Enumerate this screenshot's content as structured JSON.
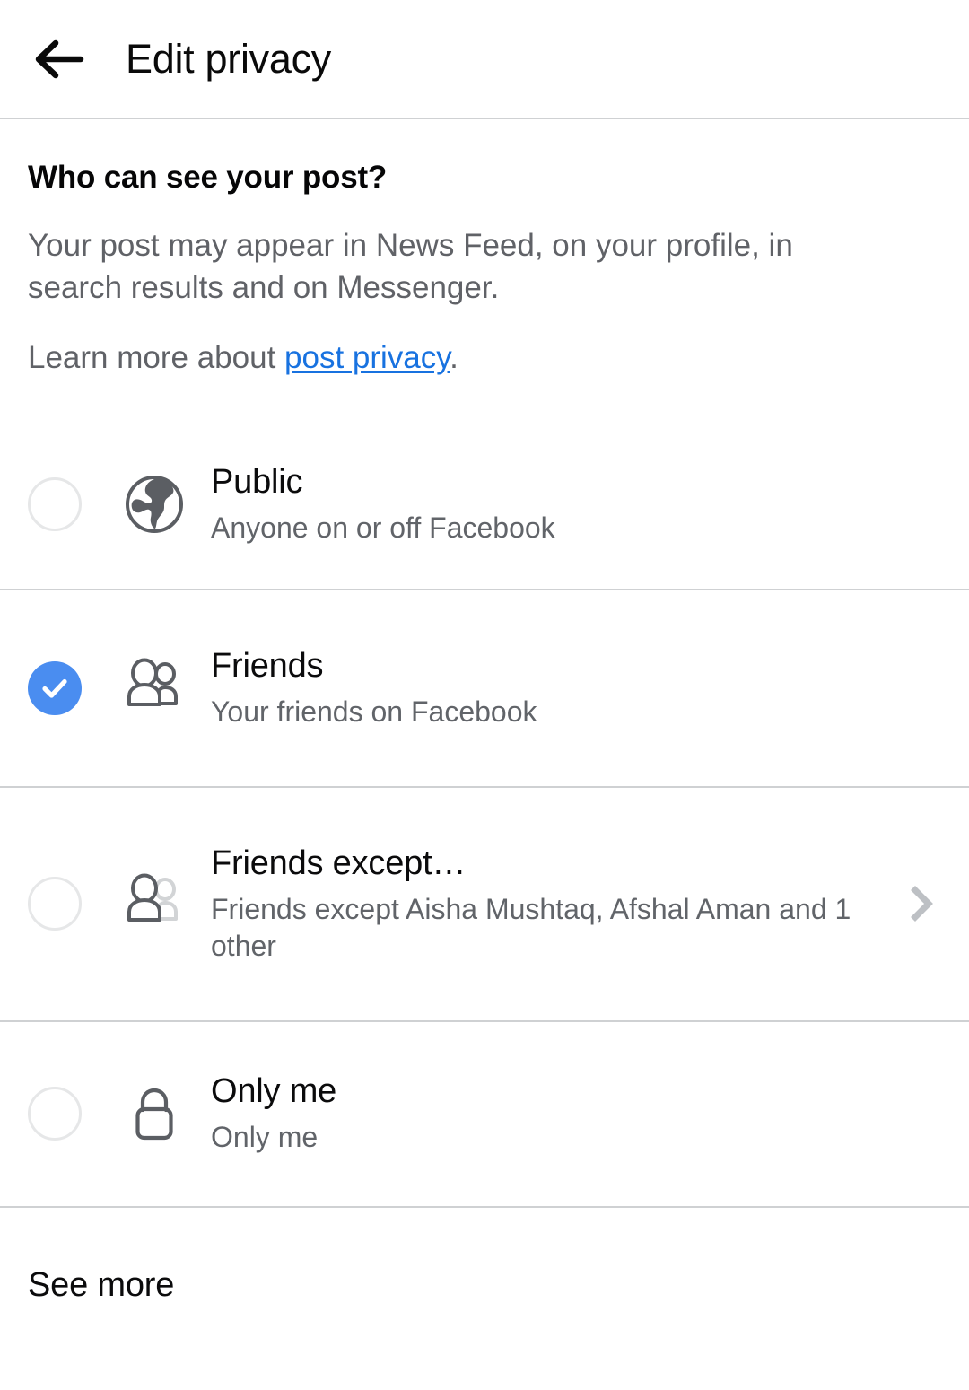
{
  "header": {
    "back_icon": "back-arrow-icon",
    "title": "Edit privacy"
  },
  "intro": {
    "heading": "Who can see your post?",
    "body": "Your post may appear in News Feed, on your profile, in search results and on Messenger.",
    "learn_prefix": "Learn more about ",
    "learn_link": "post privacy",
    "learn_suffix": "."
  },
  "options": [
    {
      "key": "public",
      "title": "Public",
      "subtitle": "Anyone on or off Facebook",
      "icon": "globe-icon",
      "selected": false,
      "has_chevron": false
    },
    {
      "key": "friends",
      "title": "Friends",
      "subtitle": "Your friends on Facebook",
      "icon": "two-people-icon",
      "selected": true,
      "has_chevron": false
    },
    {
      "key": "friends-except",
      "title": "Friends except…",
      "subtitle": "Friends except Aisha Mushtaq, Afshal Aman and 1 other",
      "icon": "people-except-icon",
      "selected": false,
      "has_chevron": true,
      "chevron_icon": "chevron-right-icon"
    },
    {
      "key": "only-me",
      "title": "Only me",
      "subtitle": "Only me",
      "icon": "lock-icon",
      "selected": false,
      "has_chevron": false
    }
  ],
  "footer": {
    "see_more_label": "See more"
  },
  "colors": {
    "selected_blue": "#4a8df0",
    "link_blue": "#1872e0",
    "divider": "#cfd1d3",
    "title_text": "#0b0b0c",
    "secondary_text": "#616469",
    "icon_gray": "#5b5e63",
    "icon_gray_light": "#d2d4d6",
    "radio_off": "#e6e7e8",
    "chevron_gray": "#bdc0c4",
    "background": "#ffffff"
  }
}
